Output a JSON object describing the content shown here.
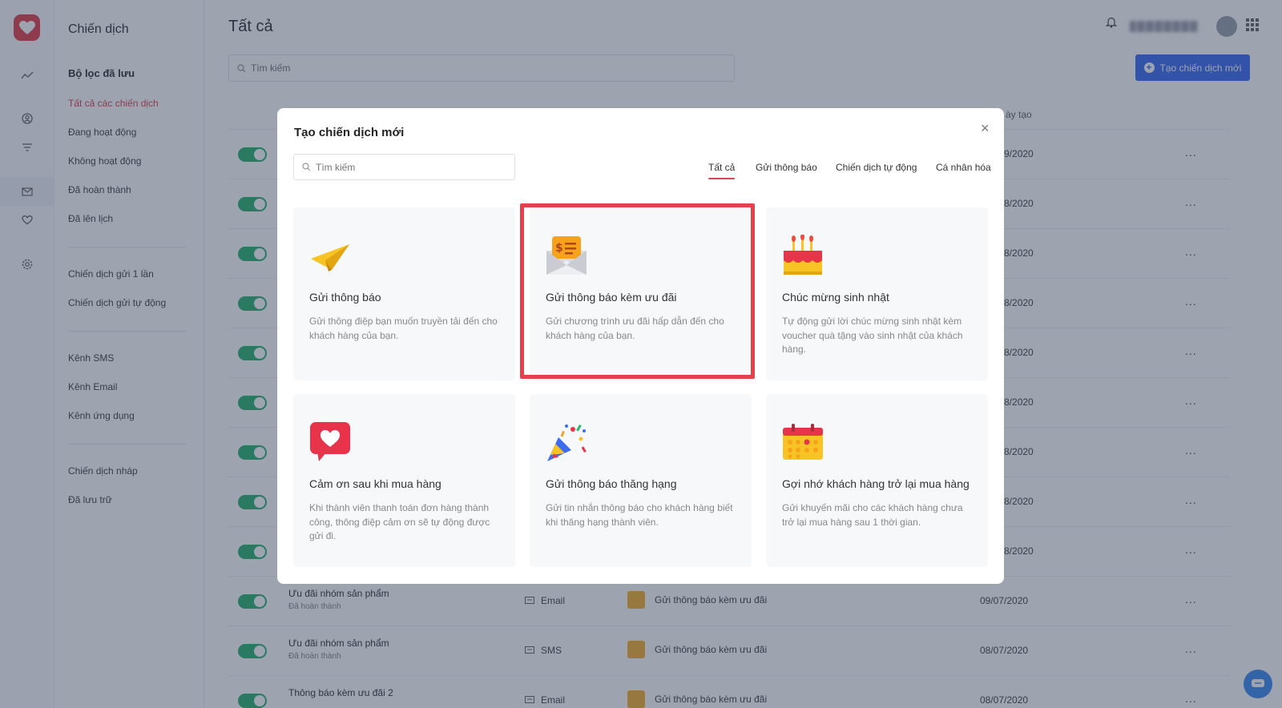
{
  "rail": {
    "icons": [
      "logo-heart-icon",
      "chart-icon",
      "user-icon",
      "filter-icon",
      "mail-icon",
      "heart-icon",
      "gear-icon"
    ]
  },
  "sidebar": {
    "title": "Chiến dịch",
    "section_title": "Bộ lọc đã lưu",
    "group1": [
      "Tất cả các chiến dịch",
      "Đang hoạt động",
      "Không hoạt động",
      "Đã hoàn thành",
      "Đã lên lịch"
    ],
    "group2": [
      "Chiến dịch gửi 1 lần",
      "Chiến dịch gửi tự động"
    ],
    "group3": [
      "Kênh SMS",
      "Kênh Email",
      "Kênh ứng dụng"
    ],
    "group4": [
      "Chiến dịch nháp",
      "Đã lưu trữ"
    ],
    "active_color": "#e0434b"
  },
  "main": {
    "title": "Tất cả",
    "search_placeholder": "Tìm kiếm",
    "create_button": "Tạo chiến dịch mới",
    "date_header_partial": "ày tạo",
    "accent_color": "#3c6df0",
    "rows_partial_dates": [
      "/09/2020",
      "/08/2020",
      "/08/2020",
      "/08/2020",
      "/08/2020",
      "/08/2020",
      "/08/2020",
      "/08/2020",
      "/08/2020"
    ],
    "rows_full": [
      {
        "name": "Ưu đãi nhóm sản phẩm",
        "status": "Đã hoàn thành",
        "channel": "Email",
        "type": "Gửi thông báo kèm ưu đãi",
        "date": "09/07/2020"
      },
      {
        "name": "Ưu đãi nhóm sản phẩm",
        "status": "Đã hoàn thành",
        "channel": "SMS",
        "type": "Gửi thông báo kèm ưu đãi",
        "date": "08/07/2020"
      },
      {
        "name": "Thông báo kèm ưu đãi 2",
        "status": "",
        "channel": "Email",
        "type": "Gửi thông báo kèm ưu đãi",
        "date": "08/07/2020"
      }
    ],
    "more_label": "..."
  },
  "modal": {
    "title": "Tạo chiến dịch mới",
    "close_label": "×",
    "search_placeholder": "Tìm kiếm",
    "tabs": [
      "Tất cả",
      "Gửi thông báo",
      "Chiến dịch tự động",
      "Cá nhân hóa"
    ],
    "active_tab": "Tất cả",
    "cards": [
      {
        "icon": "paper-plane-icon",
        "title": "Gửi thông báo",
        "desc": "Gửi thông điệp bạn muốn truyền tải đến cho khách hàng của bạn."
      },
      {
        "icon": "envelope-offer-icon",
        "title": "Gửi thông báo kèm ưu đãi",
        "desc": "Gửi chương trình ưu đãi hấp dẫn đến cho khách hàng của bạn."
      },
      {
        "icon": "birthday-cake-icon",
        "title": "Chúc mừng sinh nhật",
        "desc": "Tự động gửi lời chúc mừng sinh nhật kèm voucher quà tặng vào sinh nhật của khách hàng."
      },
      {
        "icon": "heart-bubble-icon",
        "title": "Cảm ơn sau khi mua hàng",
        "desc": "Khi thành viên thanh toán đơn hàng thành công, thông điệp cảm ơn sẽ tự động được gửi đi."
      },
      {
        "icon": "party-popper-icon",
        "title": "Gửi thông báo thăng hạng",
        "desc": "Gửi tin nhắn thông báo cho khách hàng biết khi thăng hạng thành viên."
      },
      {
        "icon": "calendar-icon",
        "title": "Gợi nhớ khách hàng trở lại mua hàng",
        "desc": "Gửi khuyến mãi cho các khách hàng chưa trở lại mua hàng sau 1 thời gian."
      }
    ],
    "highlighted_card": "Gửi thông báo kèm ưu đãi",
    "highlight_color": "#e5414c"
  }
}
